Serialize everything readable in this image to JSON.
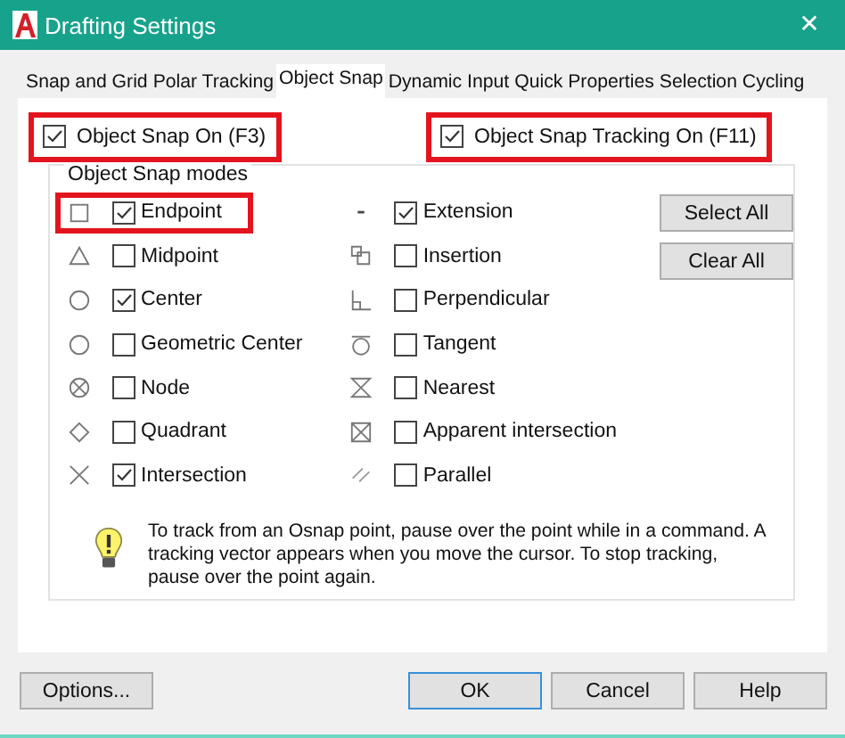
{
  "window": {
    "title": "Drafting Settings",
    "close": "✕"
  },
  "tabs": [
    {
      "label": "Snap and Grid",
      "selected": false
    },
    {
      "label": "Polar Tracking",
      "selected": false
    },
    {
      "label": "Object Snap",
      "selected": true
    },
    {
      "label": "Dynamic Input",
      "selected": false
    },
    {
      "label": "Quick Properties",
      "selected": false
    },
    {
      "label": "Selection Cycling",
      "selected": false
    }
  ],
  "toggles": [
    {
      "label": "Object Snap On (F3)",
      "checked": true,
      "highlighted": true
    },
    {
      "label": "Object Snap Tracking On (F11)",
      "checked": true,
      "highlighted": true
    }
  ],
  "modes_group": {
    "title": "Object Snap modes",
    "left": [
      {
        "label": "Endpoint",
        "checked": true,
        "kind": "endpoint",
        "highlighted": true
      },
      {
        "label": "Midpoint",
        "checked": false,
        "kind": "midpoint",
        "highlighted": false
      },
      {
        "label": "Center",
        "checked": true,
        "kind": "center",
        "highlighted": false
      },
      {
        "label": "Geometric Center",
        "checked": false,
        "kind": "center",
        "highlighted": false
      },
      {
        "label": "Node",
        "checked": false,
        "kind": "node",
        "highlighted": false
      },
      {
        "label": "Quadrant",
        "checked": false,
        "kind": "quadrant",
        "highlighted": false
      },
      {
        "label": "Intersection",
        "checked": true,
        "kind": "intersection",
        "highlighted": false
      }
    ],
    "right": [
      {
        "label": "Extension",
        "checked": true,
        "kind": "extension",
        "highlighted": false
      },
      {
        "label": "Insertion",
        "checked": false,
        "kind": "insertion",
        "highlighted": false
      },
      {
        "label": "Perpendicular",
        "checked": false,
        "kind": "perpendicular",
        "highlighted": false
      },
      {
        "label": "Tangent",
        "checked": false,
        "kind": "tangent",
        "highlighted": false
      },
      {
        "label": "Nearest",
        "checked": false,
        "kind": "nearest",
        "highlighted": false
      },
      {
        "label": "Apparent intersection",
        "checked": false,
        "kind": "apparent",
        "highlighted": false
      },
      {
        "label": "Parallel",
        "checked": false,
        "kind": "parallel",
        "highlighted": false
      }
    ],
    "buttons": [
      "Select All",
      "Clear All"
    ],
    "hint": "To track from an Osnap point, pause over the point while in a command. A tracking vector appears when you move the cursor.  To stop tracking, pause over the point again."
  },
  "footer": {
    "options": "Options...",
    "buttons": [
      "OK",
      "Cancel",
      "Help"
    ]
  }
}
